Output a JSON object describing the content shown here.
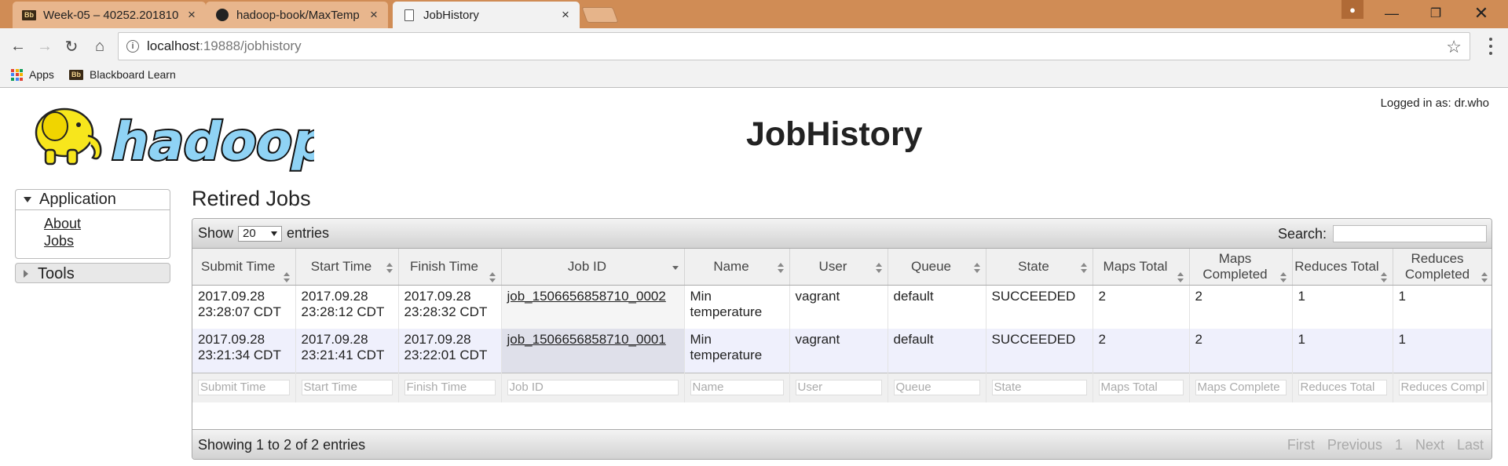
{
  "browser": {
    "tabs": [
      {
        "title": "Week-05 – 40252.201810"
      },
      {
        "title": "hadoop-book/MaxTemp"
      },
      {
        "title": "JobHistory"
      }
    ],
    "url_host": "localhost",
    "url_path": ":19888/jobhistory",
    "bookmarks": [
      {
        "label": "Apps"
      },
      {
        "label": "Blackboard Learn"
      }
    ],
    "tab_color": "#d08c55"
  },
  "header": {
    "logo_text": "hadoop",
    "title": "JobHistory",
    "logged_in": "Logged in as: dr.who"
  },
  "sidebar": {
    "application": {
      "label": "Application",
      "links": [
        {
          "label": "About"
        },
        {
          "label": "Jobs"
        }
      ]
    },
    "tools": {
      "label": "Tools"
    }
  },
  "main": {
    "section_title": "Retired Jobs",
    "show_label": "Show",
    "entries_value": "20",
    "entries_label": "entries",
    "search_label": "Search:",
    "info": "Showing 1 to 2 of 2 entries",
    "pager": [
      "First",
      "Previous",
      "1",
      "Next",
      "Last"
    ],
    "columns": [
      "Submit Time",
      "Start Time",
      "Finish Time",
      "Job ID",
      "Name",
      "User",
      "Queue",
      "State",
      "Maps Total",
      "Maps Completed",
      "Reduces Total",
      "Reduces Completed"
    ],
    "rows": [
      {
        "submit": "2017.09.28 23:28:07 CDT",
        "start": "2017.09.28 23:28:12 CDT",
        "finish": "2017.09.28 23:28:32 CDT",
        "job_id": "job_1506656858710_0002",
        "name": "Min temperature",
        "user": "vagrant",
        "queue": "default",
        "state": "SUCCEEDED",
        "maps_total": "2",
        "maps_completed": "2",
        "reduces_total": "1",
        "reduces_completed": "1"
      },
      {
        "submit": "2017.09.28 23:21:34 CDT",
        "start": "2017.09.28 23:21:41 CDT",
        "finish": "2017.09.28 23:22:01 CDT",
        "job_id": "job_1506656858710_0001",
        "name": "Min temperature",
        "user": "vagrant",
        "queue": "default",
        "state": "SUCCEEDED",
        "maps_total": "2",
        "maps_completed": "2",
        "reduces_total": "1",
        "reduces_completed": "1"
      }
    ],
    "filters": [
      "Submit Time",
      "Start Time",
      "Finish Time",
      "Job ID",
      "Name",
      "User",
      "Queue",
      "State",
      "Maps Total",
      "Maps Complete",
      "Reduces Total",
      "Reduces Compl"
    ]
  }
}
